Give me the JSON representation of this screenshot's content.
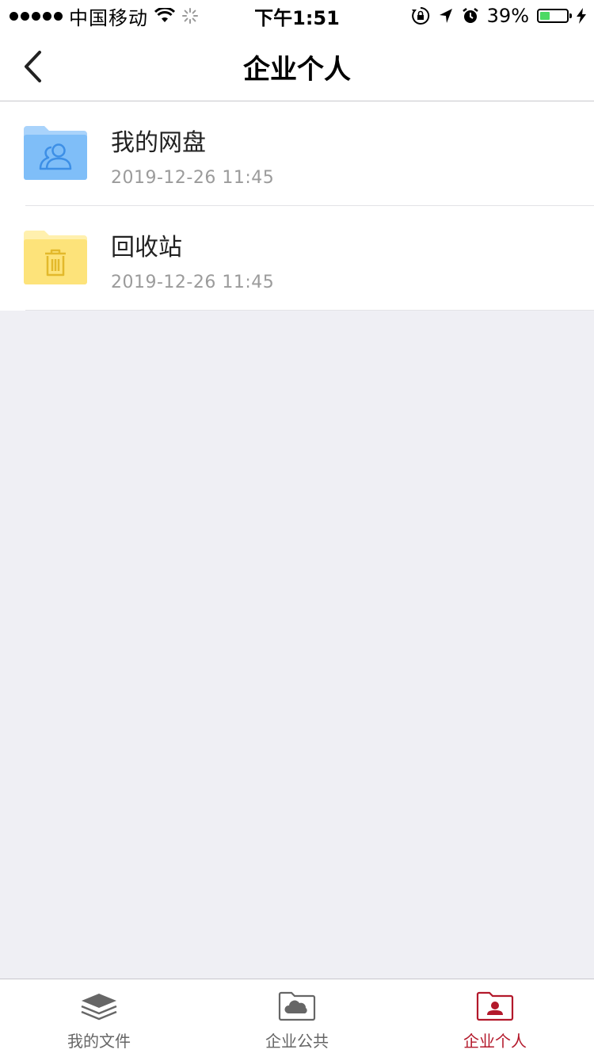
{
  "status_bar": {
    "carrier": "中国移动",
    "time": "下午1:51",
    "battery_percent": "39%",
    "battery_level": 0.39,
    "icons": [
      "signal-dots-icon",
      "wifi-icon",
      "loading-spinner-icon",
      "orientation-lock-icon",
      "location-arrow-icon",
      "alarm-icon",
      "battery-icon",
      "charging-bolt-icon"
    ]
  },
  "nav": {
    "title": "企业个人",
    "back_icon": "chevron-left-icon"
  },
  "files": [
    {
      "name": "我的网盘",
      "date": "2019-12-26 11:45",
      "icon": "shared-folder-icon",
      "color": "#7fbef8"
    },
    {
      "name": "回收站",
      "date": "2019-12-26 11:45",
      "icon": "trash-folder-icon",
      "color": "#fde37a"
    }
  ],
  "tabs": [
    {
      "label": "我的文件",
      "icon": "layers-icon",
      "active": false
    },
    {
      "label": "企业公共",
      "icon": "cloud-folder-icon",
      "active": false
    },
    {
      "label": "企业个人",
      "icon": "person-folder-icon",
      "active": true
    }
  ],
  "colors": {
    "accent": "#b3192b",
    "background": "#efeff4",
    "inactive_tab": "#666666",
    "date_text": "#9b9b9b"
  }
}
